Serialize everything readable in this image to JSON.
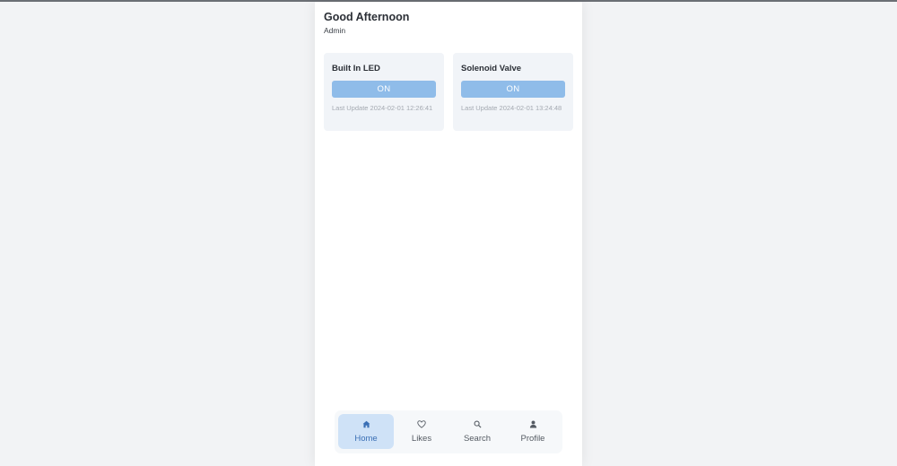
{
  "header": {
    "greeting": "Good Afternoon",
    "role": "Admin"
  },
  "devices": [
    {
      "name": "Built In LED",
      "state": "ON",
      "last_update_label": "Last Update",
      "last_update": "2024-02-01 12:26:41"
    },
    {
      "name": "Solenoid Valve",
      "state": "ON",
      "last_update_label": "Last Update",
      "last_update": "2024-02-01 13:24:48"
    }
  ],
  "bottom_nav": {
    "active": "Home",
    "items": [
      {
        "label": "Home",
        "icon": "home-icon"
      },
      {
        "label": "Likes",
        "icon": "heart-icon"
      },
      {
        "label": "Search",
        "icon": "search-icon"
      },
      {
        "label": "Profile",
        "icon": "user-icon"
      }
    ]
  },
  "colors": {
    "toggle_on": "#8fbce9",
    "active_tab_bg": "#cfe2f7",
    "active_tab_text": "#3a6fb5",
    "card_bg": "#f1f4f8"
  }
}
